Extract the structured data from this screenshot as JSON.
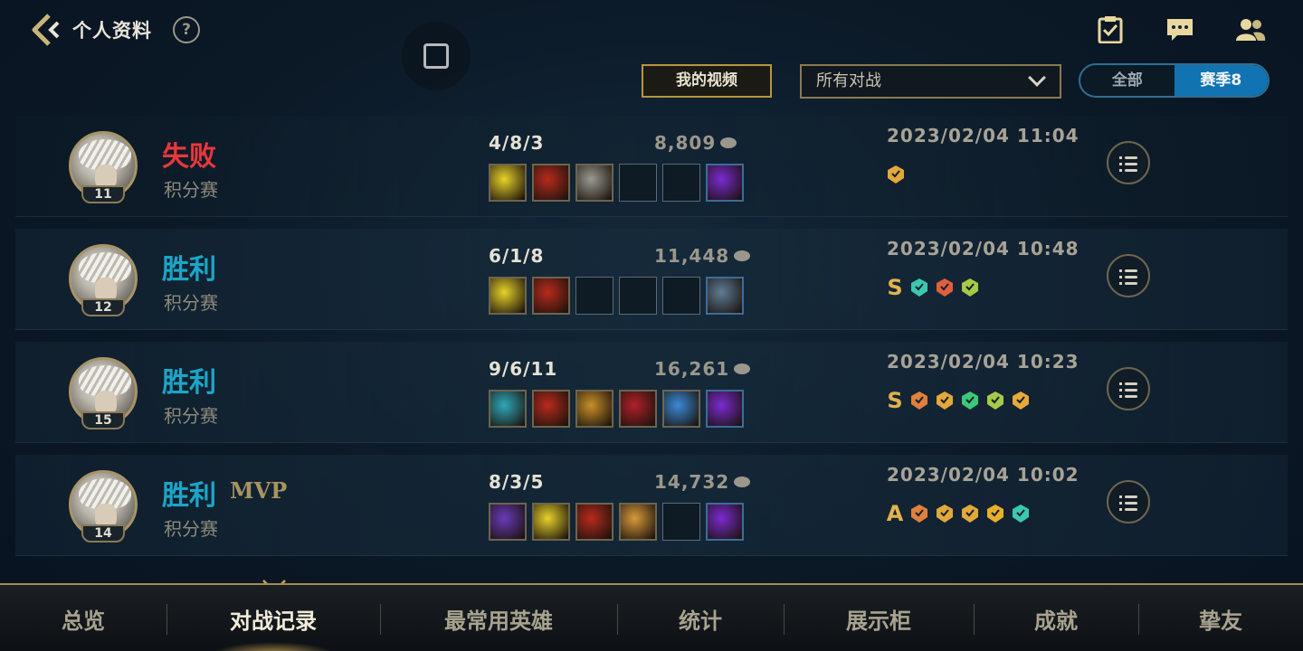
{
  "header": {
    "title": "个人资料",
    "help": "?",
    "my_video": "我的视频",
    "filter_value": "所有对战",
    "segments": [
      "全部",
      "赛季8"
    ]
  },
  "matches": [
    {
      "result": "失败",
      "result_type": "loss",
      "mvp": "",
      "mode": "积分赛",
      "level": "11",
      "kda": "4/8/3",
      "gold": "8,809",
      "date": "2023/02/04 11:04",
      "items": [
        "#e8d22a",
        "#b82a1c",
        "#9a9a90",
        "",
        "",
        "#7b2ad0"
      ],
      "grade": "",
      "badge_colors": [
        "#e2a83a"
      ]
    },
    {
      "result": "胜利",
      "result_type": "win",
      "mvp": "",
      "mode": "积分赛",
      "level": "12",
      "kda": "6/1/8",
      "gold": "11,448",
      "date": "2023/02/04 10:48",
      "items": [
        "#e8d22a",
        "#b82a1c",
        "",
        "",
        "",
        "#5e7c96"
      ],
      "grade": "S",
      "badge_colors": [
        "#3cc8b0",
        "#e0603a",
        "#a8c848"
      ]
    },
    {
      "result": "胜利",
      "result_type": "win",
      "mvp": "",
      "mode": "积分赛",
      "level": "15",
      "kda": "9/6/11",
      "gold": "16,261",
      "date": "2023/02/04 10:23",
      "items": [
        "#2fa8b8",
        "#b82a1c",
        "#c8902a",
        "#b02028",
        "#3a8ad8",
        "#7b2ad0"
      ],
      "grade": "S",
      "badge_colors": [
        "#e0803a",
        "#e2a83a",
        "#3cc878",
        "#a8c848",
        "#e8a83a"
      ]
    },
    {
      "result": "胜利",
      "result_type": "win",
      "mvp": "MVP",
      "mode": "积分赛",
      "level": "14",
      "kda": "8/3/5",
      "gold": "14,732",
      "date": "2023/02/04 10:02",
      "items": [
        "#6a3ab8",
        "#e8d22a",
        "#b82a1c",
        "#d89a3a",
        "",
        "#7b2ad0"
      ],
      "grade": "A",
      "badge_colors": [
        "#e0803a",
        "#e2a83a",
        "#e2a83a",
        "#e8b02a",
        "#3cc8b0"
      ]
    }
  ],
  "nav": [
    "总览",
    "对战记录",
    "最常用英雄",
    "统计",
    "展示柜",
    "成就",
    "挚友"
  ],
  "nav_active": 1
}
